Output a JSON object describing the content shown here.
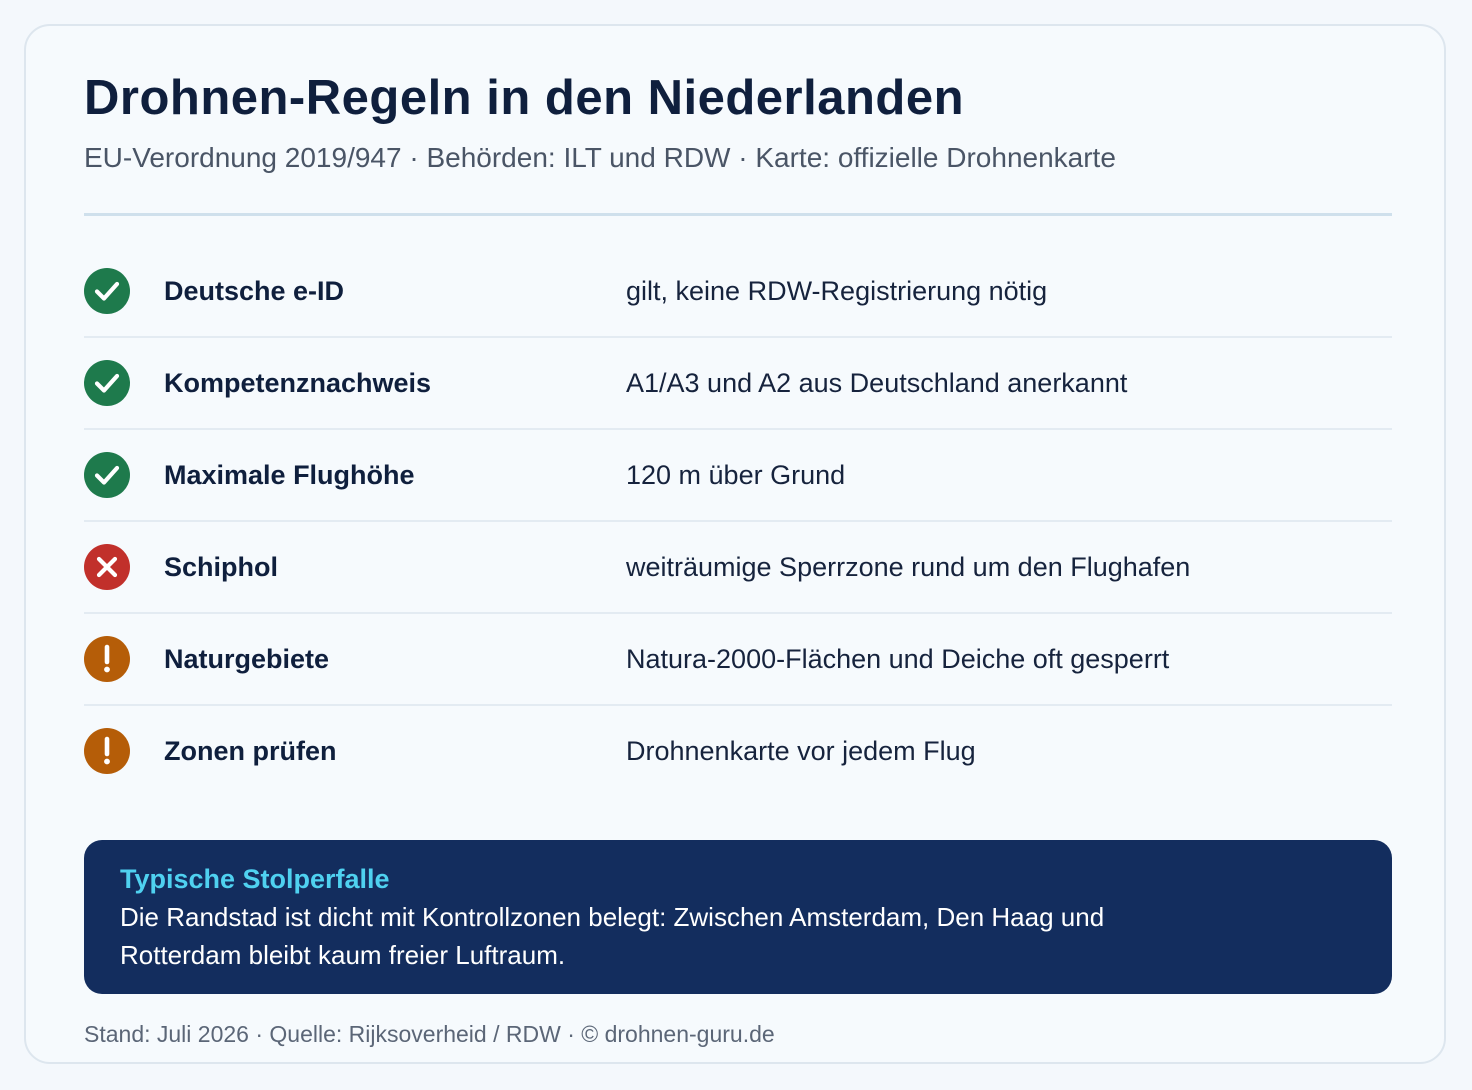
{
  "header": {
    "title": "Drohnen-Regeln in den Niederlanden",
    "subtitle": "EU-Verordnung 2019/947 · Behörden: ILT und RDW · Karte: offizielle Drohnenkarte"
  },
  "colors": {
    "ok": "#1e7a4c",
    "no": "#c1302b",
    "warn": "#b55d08",
    "callout_bg": "#132d5e",
    "callout_title": "#4fd1f0"
  },
  "rules": [
    {
      "status": "ok",
      "icon": "check-circle-icon",
      "label": "Deutsche e-ID",
      "value": "gilt, keine RDW-Registrierung nötig"
    },
    {
      "status": "ok",
      "icon": "check-circle-icon",
      "label": "Kompetenznachweis",
      "value": "A1/A3 und A2 aus Deutschland anerkannt"
    },
    {
      "status": "ok",
      "icon": "check-circle-icon",
      "label": "Maximale Flughöhe",
      "value": "120 m über Grund"
    },
    {
      "status": "no",
      "icon": "x-circle-icon",
      "label": "Schiphol",
      "value": "weiträumige Sperrzone rund um den Flughafen"
    },
    {
      "status": "warn",
      "icon": "exclamation-circle-icon",
      "label": "Naturgebiete",
      "value": "Natura-2000-Flächen und Deiche oft gesperrt"
    },
    {
      "status": "warn",
      "icon": "exclamation-circle-icon",
      "label": "Zonen prüfen",
      "value": "Drohnenkarte vor jedem Flug"
    }
  ],
  "callout": {
    "title": "Typische Stolperfalle",
    "text": "Die Randstad ist dicht mit Kontrollzonen belegt: Zwischen Amsterdam, Den Haag und Rotterdam bleibt kaum freier Luftraum."
  },
  "footer": {
    "text": "Stand: Juli 2026 · Quelle: Rijksoverheid / RDW · © drohnen-guru.de"
  }
}
